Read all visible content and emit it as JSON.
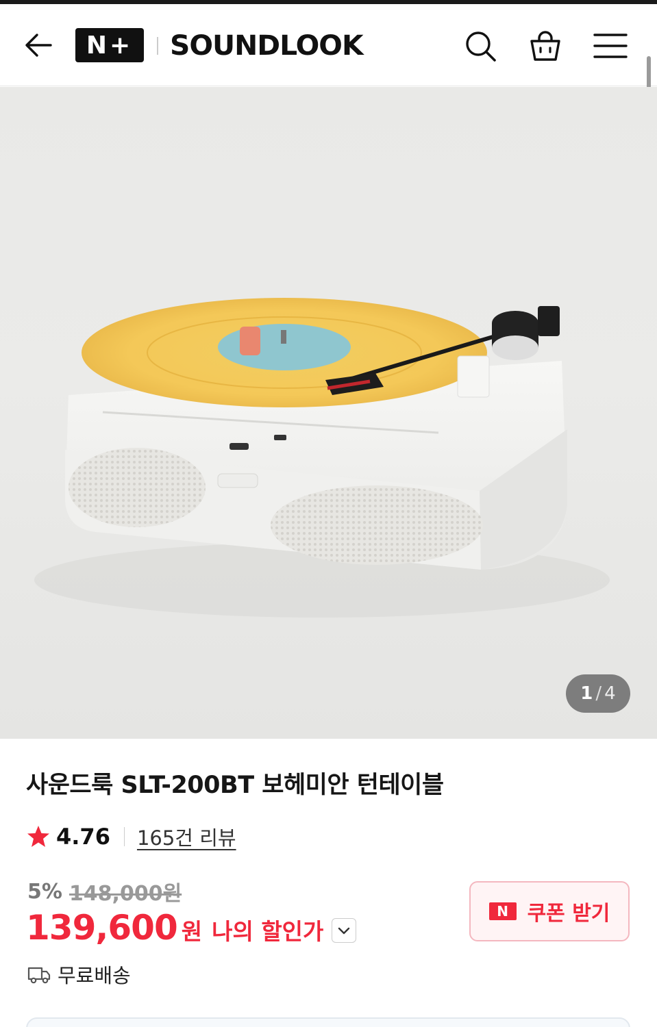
{
  "header": {
    "back_label": "뒤로",
    "nplus_text": "N+",
    "brand_name": "SOUNDLOOK"
  },
  "gallery": {
    "current": "1",
    "separator": "/",
    "total": "4",
    "progress_fraction": 0.25
  },
  "product": {
    "title": "사운드룩 SLT-200BT 보헤미안 턴테이블",
    "rating": "4.76",
    "review_count": "165건 리뷰",
    "discount_rate": "5%",
    "original_price": "148,000원",
    "sale_price": "139,600",
    "currency": "원",
    "my_price_label": "나의 할인가",
    "coupon_badge": "N",
    "coupon_label": "쿠폰 받기",
    "shipping_label": "무료배송"
  },
  "colors": {
    "accent_red": "#f0283c",
    "coupon_bg": "#fff4f5",
    "coupon_border": "#f4b7bf",
    "logo_black": "#111111"
  },
  "icons": {
    "back": "arrow-left-icon",
    "search": "search-icon",
    "cart": "shopping-bag-icon",
    "menu": "hamburger-menu-icon",
    "star": "star-icon",
    "chevron": "chevron-down-icon",
    "truck": "truck-icon"
  }
}
